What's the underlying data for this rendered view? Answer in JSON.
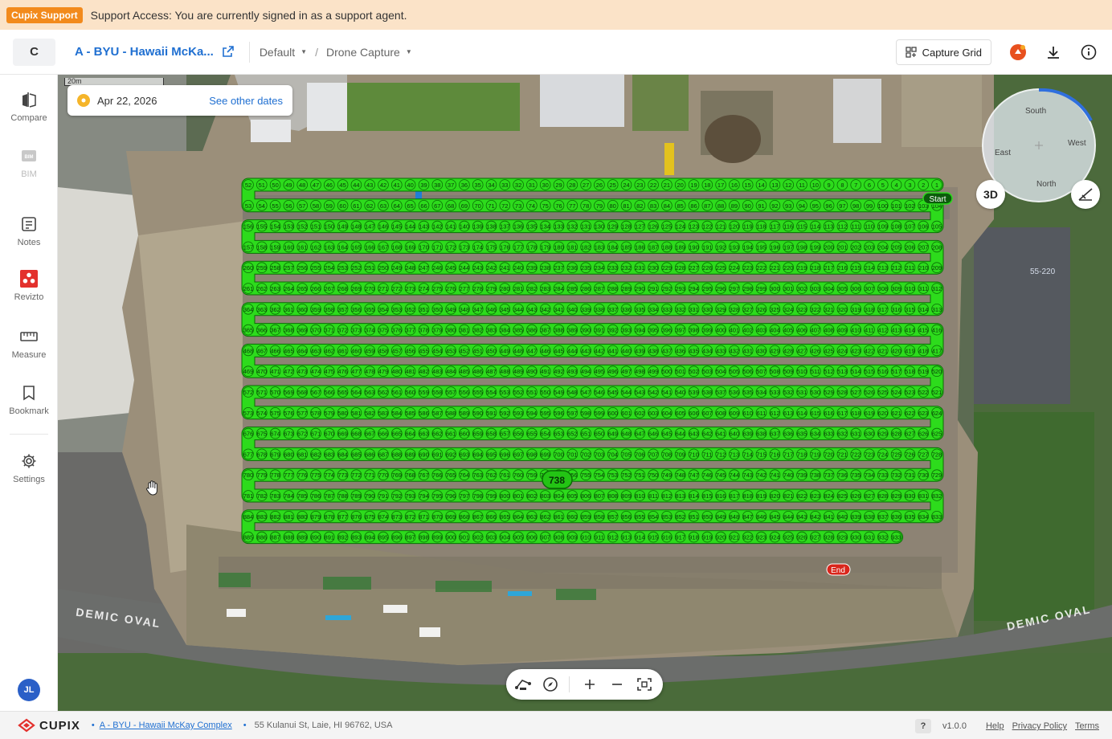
{
  "banner": {
    "badge": "Cupix Support",
    "message": "Support Access: You are currently signed in as a support agent."
  },
  "header": {
    "logo_letter": "C",
    "project_name": "A - BYU - Hawaii McKa...",
    "view": "Default",
    "capture": "Drone Capture",
    "capture_grid_label": "Capture Grid"
  },
  "sidebar": {
    "items": [
      {
        "label": "Compare",
        "icon": "compare-icon"
      },
      {
        "label": "BIM",
        "icon": "bim-icon"
      },
      {
        "label": "Notes",
        "icon": "notes-icon"
      },
      {
        "label": "Revizto",
        "icon": "revizto-icon"
      },
      {
        "label": "Measure",
        "icon": "measure-icon"
      },
      {
        "label": "Bookmark",
        "icon": "bookmark-icon"
      },
      {
        "label": "Settings",
        "icon": "settings-icon"
      }
    ],
    "avatar": "JL"
  },
  "map": {
    "scale_label": "20m",
    "date": "Apr 22, 2026",
    "see_other_dates": "See other dates",
    "compass": {
      "south": "South",
      "east": "East",
      "west": "West",
      "north": "North"
    },
    "btn_3d": "3D",
    "start_label": "Start",
    "end_label": "End",
    "highlight_number": "738",
    "road_label_left": "DEMIC OVAL",
    "road_label_right": "DEMIC OVAL",
    "parcel_label": "55-220",
    "track": {
      "total_points": 933
    },
    "colors": {
      "track": "#2ddb1c",
      "track_outline": "#0a6d05",
      "start_bg": "#0b5d0b",
      "end_bg": "#d9261c"
    }
  },
  "footer": {
    "brand": "CUPIX",
    "project_link": "A - BYU - Hawaii McKay Complex",
    "address": "55 Kulanui St, Laie, HI 96762, USA",
    "help_q": "?",
    "version": "v1.0.0",
    "help": "Help",
    "privacy": "Privacy Policy",
    "terms": "Terms"
  }
}
